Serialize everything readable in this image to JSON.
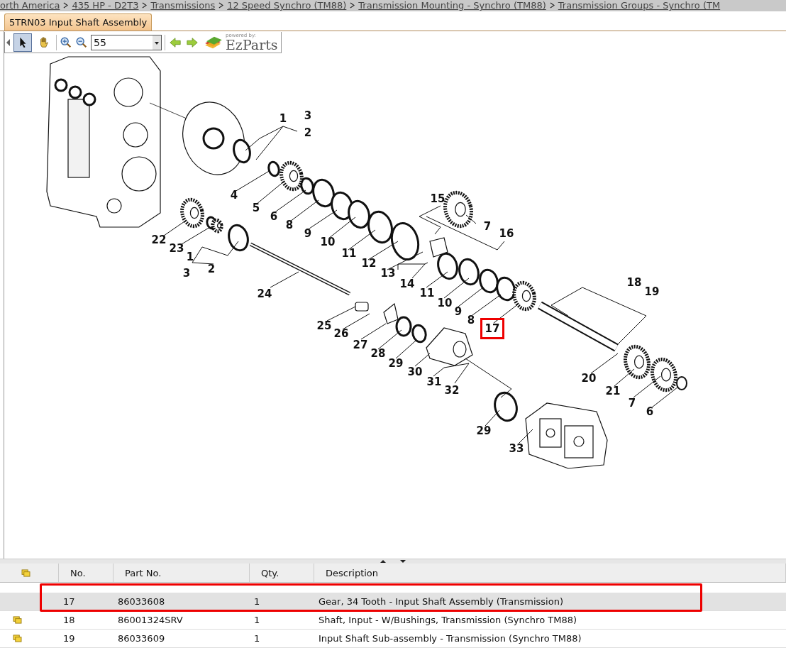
{
  "breadcrumb": [
    "orth America",
    "435 HP - D2T3",
    "Transmissions",
    "12 Speed Synchro (TM88)",
    "Transmission Mounting - Synchro (TM88)",
    "Transmission Groups - Synchro (TM"
  ],
  "tab": {
    "label": "5TRN03 Input Shaft Assembly",
    "selected": true
  },
  "toolbar": {
    "tools": [
      {
        "kind": "pointer",
        "selected": true
      },
      {
        "kind": "hand",
        "selected": false
      }
    ],
    "zoom_value": "55",
    "logo": {
      "tagline": "powered by:",
      "name": "EzParts"
    }
  },
  "diagram": {
    "callouts": [
      {
        "label": "1",
        "highlighted": false
      },
      {
        "label": "3",
        "highlighted": false
      },
      {
        "label": "2",
        "highlighted": false
      },
      {
        "label": "4",
        "highlighted": false
      },
      {
        "label": "5",
        "highlighted": false
      },
      {
        "label": "6",
        "highlighted": false
      },
      {
        "label": "8",
        "highlighted": false
      },
      {
        "label": "9",
        "highlighted": false
      },
      {
        "label": "10",
        "highlighted": false
      },
      {
        "label": "11",
        "highlighted": false
      },
      {
        "label": "12",
        "highlighted": false
      },
      {
        "label": "13",
        "highlighted": false
      },
      {
        "label": "14",
        "highlighted": false
      },
      {
        "label": "15",
        "highlighted": false
      },
      {
        "label": "7",
        "highlighted": false
      },
      {
        "label": "16",
        "highlighted": false
      },
      {
        "label": "22",
        "highlighted": false
      },
      {
        "label": "23",
        "highlighted": false
      },
      {
        "label": "1",
        "highlighted": false
      },
      {
        "label": "3",
        "highlighted": false
      },
      {
        "label": "2",
        "highlighted": false
      },
      {
        "label": "24",
        "highlighted": false
      },
      {
        "label": "11",
        "highlighted": false
      },
      {
        "label": "10",
        "highlighted": false
      },
      {
        "label": "9",
        "highlighted": false
      },
      {
        "label": "8",
        "highlighted": false
      },
      {
        "label": "17",
        "highlighted": true
      },
      {
        "label": "18",
        "highlighted": false
      },
      {
        "label": "19",
        "highlighted": false
      },
      {
        "label": "25",
        "highlighted": false
      },
      {
        "label": "26",
        "highlighted": false
      },
      {
        "label": "27",
        "highlighted": false
      },
      {
        "label": "28",
        "highlighted": false
      },
      {
        "label": "29",
        "highlighted": false
      },
      {
        "label": "30",
        "highlighted": false
      },
      {
        "label": "31",
        "highlighted": false
      },
      {
        "label": "32",
        "highlighted": false
      },
      {
        "label": "20",
        "highlighted": false
      },
      {
        "label": "21",
        "highlighted": false
      },
      {
        "label": "7",
        "highlighted": false
      },
      {
        "label": "6",
        "highlighted": false
      },
      {
        "label": "29",
        "highlighted": false
      },
      {
        "label": "33",
        "highlighted": false
      }
    ]
  },
  "table": {
    "columns": [
      "No.",
      "Part No.",
      "Qty.",
      "Description"
    ],
    "rows": [
      {
        "no": "17",
        "part_no": "86033608",
        "qty": "1",
        "description": "Gear, 34 Tooth - Input Shaft Assembly (Transmission)",
        "selected": true,
        "flagged": false,
        "highlighted": true
      },
      {
        "no": "18",
        "part_no": "86001324SRV",
        "qty": "1",
        "description": "Shaft, Input - W/Bushings, Transmission (Synchro TM88)",
        "selected": false,
        "flagged": true,
        "highlighted": false
      },
      {
        "no": "19",
        "part_no": "86033609",
        "qty": "1",
        "description": "Input Shaft Sub-assembly - Transmission (Synchro TM88)",
        "selected": false,
        "flagged": true,
        "highlighted": false
      }
    ]
  }
}
